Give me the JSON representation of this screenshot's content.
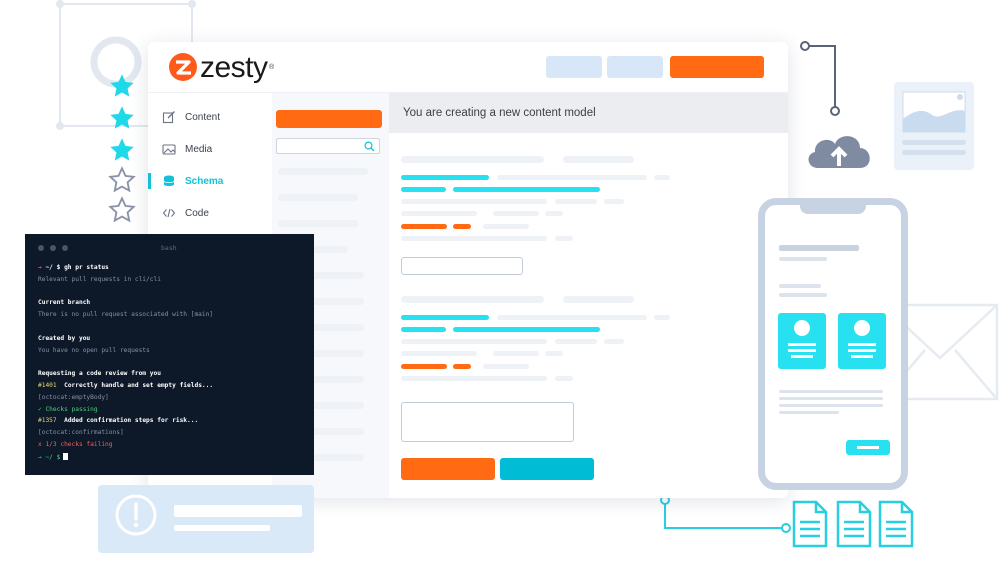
{
  "app": {
    "brand": "zesty",
    "trademark": "®",
    "nav": [
      {
        "label": "Content",
        "icon": "edit-icon",
        "active": false
      },
      {
        "label": "Media",
        "icon": "media-icon",
        "active": false
      },
      {
        "label": "Schema",
        "icon": "database-icon",
        "active": true
      },
      {
        "label": "Code",
        "icon": "code-icon",
        "active": false
      }
    ],
    "search": {
      "placeholder": ""
    },
    "main_header": "You are creating a new content model"
  },
  "terminal": {
    "title": "bash",
    "lines": [
      {
        "text": "→ ~/ $ gh pr status",
        "style": "b"
      },
      {
        "text": "Relevant pull requests in cli/cli",
        "style": ""
      },
      {
        "text": "",
        "style": ""
      },
      {
        "text": "Current branch",
        "style": "b"
      },
      {
        "text": "There is no pull request associated with [main]",
        "style": ""
      },
      {
        "text": "",
        "style": ""
      },
      {
        "text": "Created by you",
        "style": "b"
      },
      {
        "text": "You have no open pull requests",
        "style": ""
      },
      {
        "text": "",
        "style": ""
      },
      {
        "text": "Requesting a code review from you",
        "style": "b"
      },
      {
        "text": "#1401  Correctly handle and set empty fields...",
        "style": "by"
      },
      {
        "text": "[octocat:emptyBody]",
        "style": ""
      },
      {
        "text": "✓ Checks passing",
        "style": "g"
      },
      {
        "text": "#1357  Added confirmation steps for risk...",
        "style": "by"
      },
      {
        "text": "[octocat:confirmations]",
        "style": ""
      },
      {
        "text": "x 1/3 checks failing",
        "style": "r"
      },
      {
        "text": "→ ~/ $",
        "style": "g"
      }
    ]
  },
  "colors": {
    "accent_orange": "#ff6a13",
    "accent_cyan": "#27e0f0",
    "teal_button": "#00bcd4"
  },
  "icons": [
    "search-icon",
    "star-icon",
    "cloud-upload-icon",
    "image-icon",
    "mail-icon",
    "document-icon",
    "alert-icon"
  ]
}
